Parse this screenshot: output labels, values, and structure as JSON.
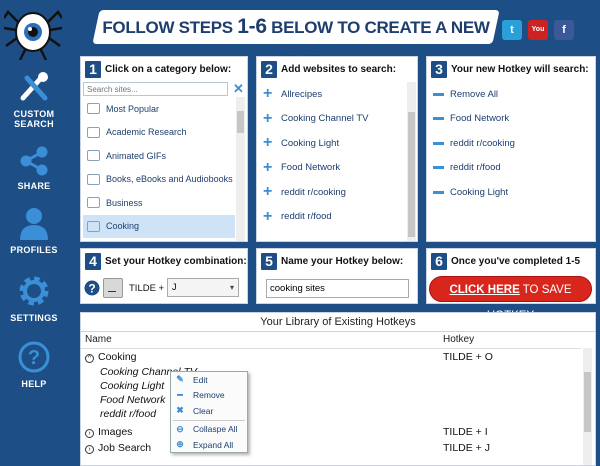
{
  "header": {
    "title_pre": "FOLLOW STEPS ",
    "title_big": "1-6",
    "title_post": " BELOW TO CREATE A NEW HOTKEY"
  },
  "social": [
    {
      "name": "twitter",
      "glyph": "t",
      "color": "#2a9fd8"
    },
    {
      "name": "youtube",
      "glyph": "You",
      "color": "#cc2222"
    },
    {
      "name": "facebook",
      "glyph": "f",
      "color": "#3b5998"
    }
  ],
  "sidebar": {
    "items": [
      {
        "label": "CUSTOM SEARCH"
      },
      {
        "label": "SHARE"
      },
      {
        "label": "PROFILES"
      },
      {
        "label": "SETTINGS"
      },
      {
        "label": "HELP"
      }
    ]
  },
  "step1": {
    "num": "1",
    "title": "Click on a category below:",
    "search_placeholder": "Search sites...",
    "categories": [
      "Most Popular",
      "Academic Research",
      "Animated GIFs",
      "Books, eBooks and Audiobooks",
      "Business",
      "Cooking"
    ],
    "selected": "Cooking"
  },
  "step2": {
    "num": "2",
    "title": "Add websites to search:",
    "sites": [
      "Allrecipes",
      "Cooking Channel TV",
      "Cooking Light",
      "Food Network",
      "reddit r/cooking",
      "reddit r/food"
    ]
  },
  "step3": {
    "num": "3",
    "title": "Your new Hotkey will search:",
    "items": [
      "Remove All",
      "Food Network",
      "reddit r/cooking",
      "reddit r/food",
      "Cooking Light"
    ]
  },
  "step4": {
    "num": "4",
    "title": "Set your Hotkey combination:",
    "modifier": "TILDE +",
    "key": "J"
  },
  "step5": {
    "num": "5",
    "title": "Name your Hotkey below:",
    "name_value": "cooking sites"
  },
  "step6": {
    "num": "6",
    "title": "Once you've completed 1-5",
    "button_click": "CLICK HERE",
    "button_rest": " TO SAVE HOTKEY"
  },
  "library": {
    "title": "Your Library of Existing Hotkeys",
    "col_name": "Name",
    "col_hotkey": "Hotkey",
    "rows": [
      {
        "name": "Cooking",
        "hotkey": "TILDE + O"
      },
      {
        "name": "Cooking Channel TV",
        "hotkey": ""
      },
      {
        "name": "Cooking Light",
        "hotkey": ""
      },
      {
        "name": "Food Network",
        "hotkey": ""
      },
      {
        "name": "reddit r/food",
        "hotkey": ""
      },
      {
        "name": "Images",
        "hotkey": "TILDE + I"
      },
      {
        "name": "Job Search",
        "hotkey": "TILDE + J"
      }
    ]
  },
  "context_menu": {
    "items": [
      "Edit",
      "Remove",
      "Clear",
      "Collaspe All",
      "Expand All"
    ]
  }
}
